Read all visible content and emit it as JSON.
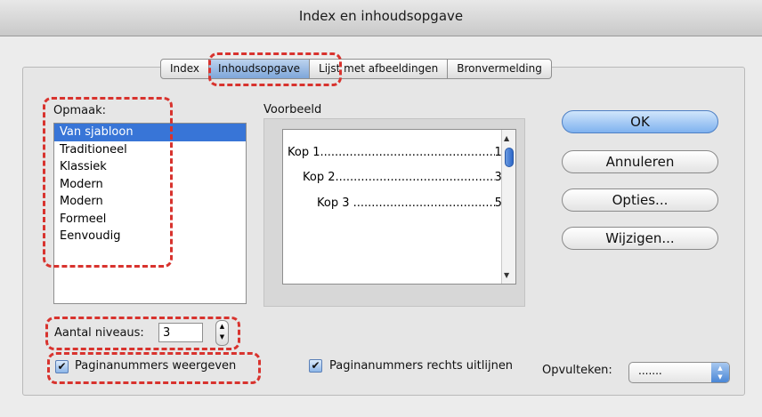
{
  "window": {
    "title": "Index en inhoudsopgave"
  },
  "tabs": [
    {
      "label": "Index",
      "active": false
    },
    {
      "label": "Inhoudsopgave",
      "active": true
    },
    {
      "label": "Lijst met afbeeldingen",
      "active": false
    },
    {
      "label": "Bronvermelding",
      "active": false
    }
  ],
  "format": {
    "label": "Opmaak:",
    "selected": "Van sjabloon",
    "items": [
      "Van sjabloon",
      "Traditioneel",
      "Klassiek",
      "Modern",
      "Modern",
      "Formeel",
      "Eenvoudig"
    ]
  },
  "preview": {
    "label": "Voorbeeld",
    "lines": [
      {
        "text": "Kop 1",
        "page": "1"
      },
      {
        "text": "Kop 2",
        "page": "3"
      },
      {
        "text": "Kop 3 ",
        "page": "5"
      }
    ]
  },
  "buttons": {
    "ok": "OK",
    "cancel": "Annuleren",
    "options": "Opties...",
    "modify": "Wijzigen..."
  },
  "levels": {
    "label": "Aantal niveaus:",
    "value": "3"
  },
  "show_page_numbers": {
    "label": "Paginanummers weergeven",
    "checked": true
  },
  "right_align": {
    "label": "Paginanummers rechts uitlijnen",
    "checked": true
  },
  "tab_leader": {
    "label": "Opvulteken:",
    "value": "......."
  },
  "colors": {
    "accent": "#3875d7",
    "highlight": "#d8332e"
  }
}
